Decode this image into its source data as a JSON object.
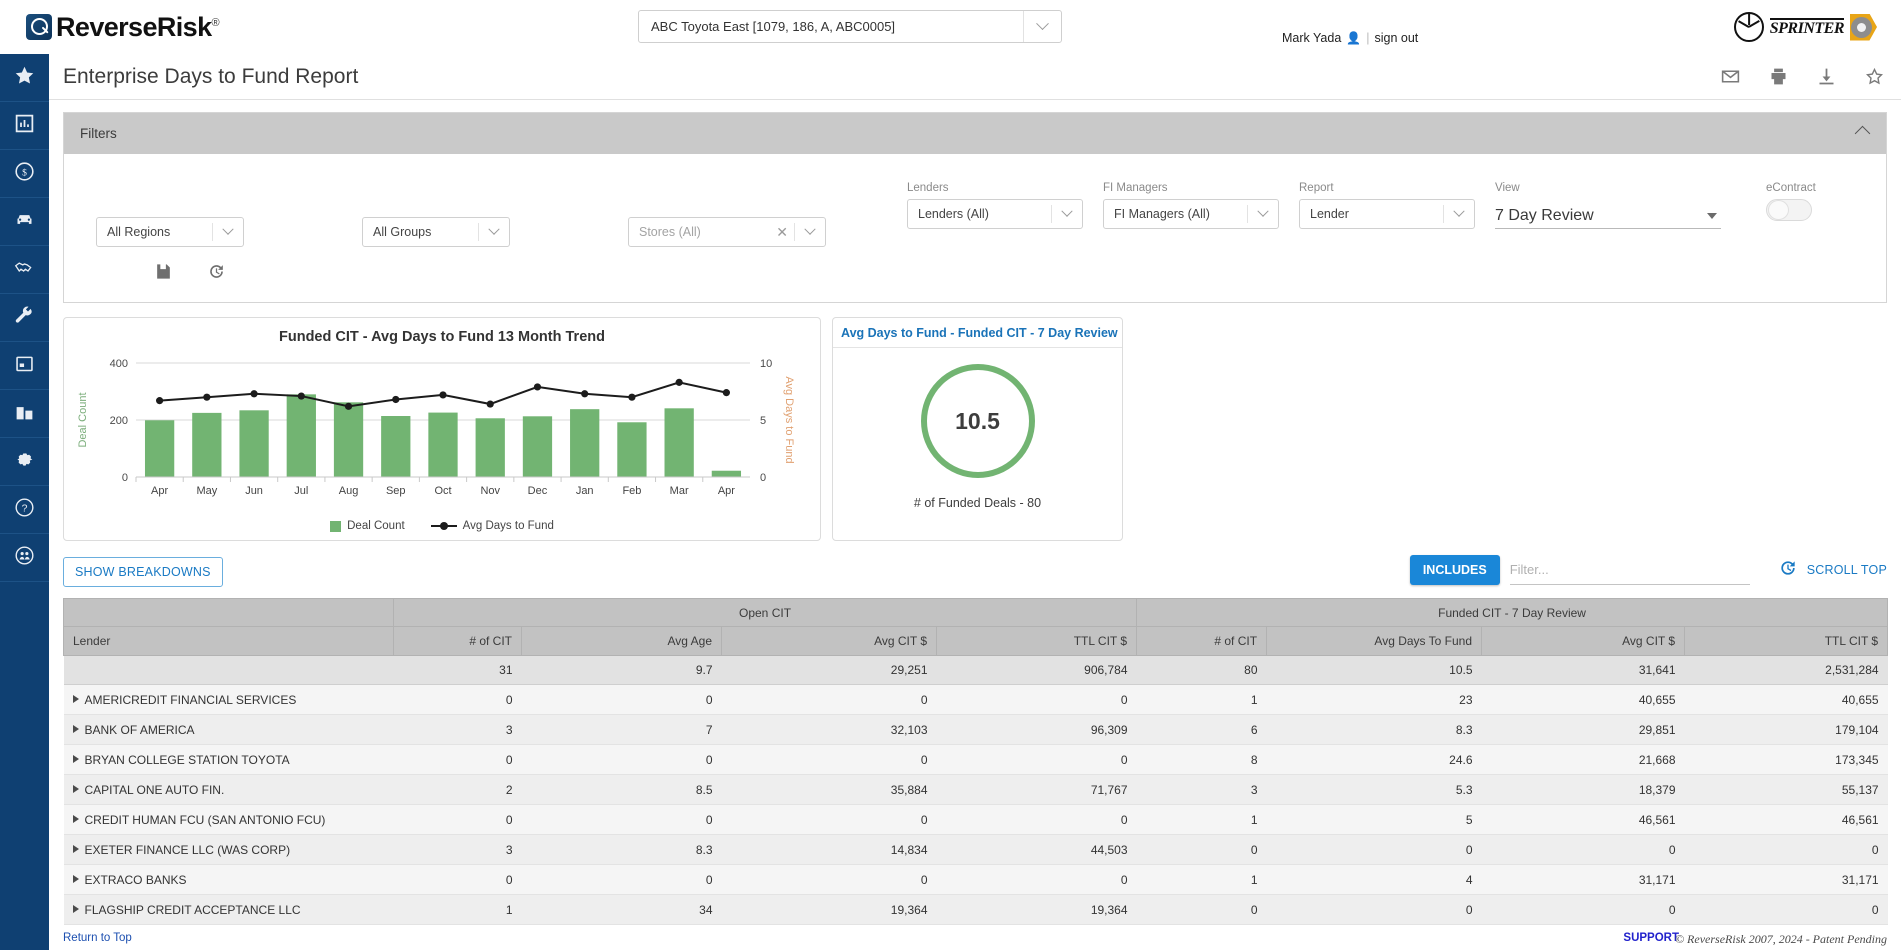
{
  "brand": {
    "name": "ReverseRisk",
    "registered": "®"
  },
  "topbar": {
    "store_value": "ABC Toyota East [1079, 186, A, ABC0005]",
    "user_name": "Mark Yada",
    "sign_out": "sign out",
    "sprinter_word": "SPRINTER"
  },
  "sidebar": {
    "items": [
      {
        "name": "favorites",
        "icon": "star-icon"
      },
      {
        "name": "reports",
        "icon": "bar-chart-icon"
      },
      {
        "name": "finance",
        "icon": "dollar-circle-icon"
      },
      {
        "name": "vehicles",
        "icon": "car-icon"
      },
      {
        "name": "deals",
        "icon": "handshake-icon"
      },
      {
        "name": "tools",
        "icon": "wrench-icon"
      },
      {
        "name": "calendar",
        "icon": "calendar-icon"
      },
      {
        "name": "dealership",
        "icon": "building-icon"
      },
      {
        "name": "settings",
        "icon": "gear-icon"
      },
      {
        "name": "help",
        "icon": "question-circle-icon"
      },
      {
        "name": "users",
        "icon": "users-circle-icon"
      }
    ]
  },
  "page": {
    "title": "Enterprise Days to Fund Report",
    "actions": [
      {
        "name": "email",
        "icon": "mail-icon"
      },
      {
        "name": "print",
        "icon": "printer-icon"
      },
      {
        "name": "download",
        "icon": "download-icon"
      },
      {
        "name": "favorite",
        "icon": "star-outline-icon"
      }
    ]
  },
  "filters": {
    "header": "Filters",
    "collapse_icon": "chevron-up-icon",
    "fields": [
      {
        "label": "",
        "value": "All Regions",
        "type": "select"
      },
      {
        "label": "",
        "value": "All Groups",
        "type": "select"
      },
      {
        "label": "",
        "value": "Stores (All)",
        "type": "select-clear",
        "placeholder": true
      },
      {
        "label": "Lenders",
        "value": "Lenders (All)",
        "type": "select"
      },
      {
        "label": "FI Managers",
        "value": "FI Managers (All)",
        "type": "select"
      },
      {
        "label": "Report",
        "value": "Lender",
        "type": "select"
      },
      {
        "label": "View",
        "value": "7 Day Review",
        "type": "underline"
      },
      {
        "label": "eContract",
        "value": "off",
        "type": "toggle"
      }
    ],
    "buttons": [
      {
        "name": "save-filter",
        "icon": "save-icon"
      },
      {
        "name": "filter-history",
        "icon": "history-icon"
      }
    ]
  },
  "chart_data": [
    {
      "type": "bar",
      "title": "Funded CIT - Avg Days to Fund 13 Month Trend",
      "categories": [
        "Apr",
        "May",
        "Jun",
        "Jul",
        "Aug",
        "Sep",
        "Oct",
        "Nov",
        "Dec",
        "Jan",
        "Feb",
        "Mar",
        "Apr"
      ],
      "series": [
        {
          "name": "Deal Count",
          "type": "bar",
          "color": "#72b472",
          "axis": "left",
          "values": [
            199,
            225,
            234,
            290,
            262,
            214,
            226,
            206,
            213,
            238,
            192,
            241,
            22
          ]
        },
        {
          "name": "Avg Days to Fund",
          "type": "line",
          "color": "#1c1c1c",
          "axis": "right",
          "values": [
            6.7,
            7.0,
            7.3,
            7.1,
            6.2,
            6.8,
            7.2,
            6.4,
            7.9,
            7.3,
            7.0,
            8.3,
            7.4
          ]
        }
      ],
      "ylabel": "Deal Count",
      "ylabel_right": "Avg Days to Fund",
      "yticks": [
        0,
        200,
        400
      ],
      "yticks_right": [
        0,
        5,
        10
      ],
      "ylim": [
        0,
        400
      ],
      "ylim_right": [
        0,
        10
      ],
      "legend": [
        "Deal Count",
        "Avg Days to Fund"
      ],
      "legend_position": "bottom"
    },
    {
      "type": "gauge",
      "title": "Avg Days to Fund - Funded CIT - 7 Day Review",
      "value": "10.5",
      "subtitle": "# of Funded Deals - 80",
      "ring_color": "#72b472"
    }
  ],
  "table_controls": {
    "show_breakdowns": "SHOW BREAKDOWNS",
    "includes": "INCLUDES",
    "filter_placeholder": "Filter...",
    "filter_value": "",
    "history_icon": "history-icon",
    "scroll_top": "SCROLL TOP"
  },
  "table": {
    "group_headers": [
      {
        "label": "",
        "span": 1
      },
      {
        "label": "Open CIT",
        "span": 4
      },
      {
        "label": "Funded CIT - 7 Day Review",
        "span": 4
      }
    ],
    "columns": [
      "Lender",
      "# of CIT",
      "Avg Age",
      "Avg CIT $",
      "TTL CIT $",
      "# of CIT",
      "Avg Days To Fund",
      "Avg CIT $",
      "TTL CIT $"
    ],
    "totals": [
      "",
      "31",
      "9.7",
      "29,251",
      "906,784",
      "80",
      "10.5",
      "31,641",
      "2,531,284"
    ],
    "rows": [
      {
        "name": "AMERICREDIT FINANCIAL SERVICES",
        "cells": [
          "0",
          "0",
          "0",
          "0",
          "1",
          "23",
          "40,655",
          "40,655"
        ]
      },
      {
        "name": "BANK OF AMERICA",
        "cells": [
          "3",
          "7",
          "32,103",
          "96,309",
          "6",
          "8.3",
          "29,851",
          "179,104"
        ]
      },
      {
        "name": "BRYAN COLLEGE STATION TOYOTA",
        "cells": [
          "0",
          "0",
          "0",
          "0",
          "8",
          "24.6",
          "21,668",
          "173,345"
        ]
      },
      {
        "name": "CAPITAL ONE AUTO FIN.",
        "cells": [
          "2",
          "8.5",
          "35,884",
          "71,767",
          "3",
          "5.3",
          "18,379",
          "55,137"
        ]
      },
      {
        "name": "CREDIT HUMAN FCU (SAN ANTONIO FCU)",
        "cells": [
          "0",
          "0",
          "0",
          "0",
          "1",
          "5",
          "46,561",
          "46,561"
        ]
      },
      {
        "name": "EXETER FINANCE LLC (WAS CORP)",
        "cells": [
          "3",
          "8.3",
          "14,834",
          "44,503",
          "0",
          "0",
          "0",
          "0"
        ]
      },
      {
        "name": "EXTRACO BANKS",
        "cells": [
          "0",
          "0",
          "0",
          "0",
          "1",
          "4",
          "31,171",
          "31,171"
        ]
      },
      {
        "name": "FLAGSHIP CREDIT ACCEPTANCE LLC",
        "cells": [
          "1",
          "34",
          "19,364",
          "19,364",
          "0",
          "0",
          "0",
          "0"
        ]
      }
    ]
  },
  "footer": {
    "return_to_top": "Return to Top",
    "support": "SUPPORT",
    "copyright": "© ReverseRisk 2007, 2024 - Patent Pending"
  }
}
